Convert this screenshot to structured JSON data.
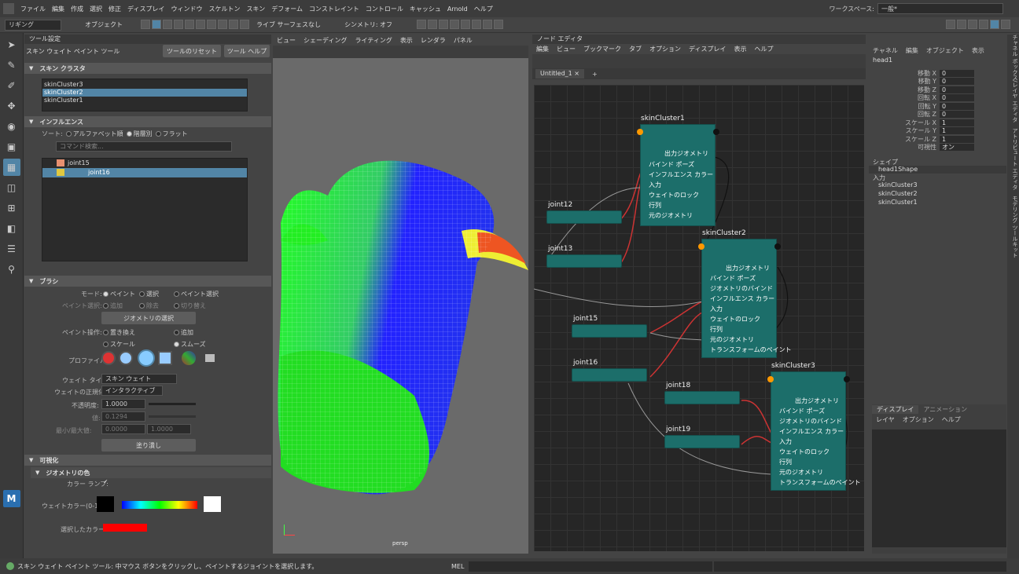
{
  "menu": [
    "ファイル",
    "編集",
    "作成",
    "選択",
    "修正",
    "ディスプレイ",
    "ウィンドウ",
    "スケルトン",
    "スキン",
    "デフォーム",
    "コンストレイント",
    "コントロール",
    "キャッシュ",
    "Arnold",
    "ヘルプ"
  ],
  "workspace": {
    "label": "ワークスペース:",
    "value": "一般*"
  },
  "shelf": {
    "mode": "リギング",
    "objects": "オブジェクト",
    "live": "ライブ サーフェスなし",
    "symmetry": "シンメトリ: オフ"
  },
  "tool": {
    "header": "ツール設定",
    "name": "スキン ウェイト ペイント ツール",
    "reset": "ツールのリセット",
    "help": "ツール ヘルプ"
  },
  "skin_cluster": {
    "title": "スキン クラスタ",
    "items": [
      "skinCluster3",
      "skinCluster2",
      "skinCluster1"
    ],
    "selected": 1
  },
  "influence": {
    "title": "インフルエンス",
    "sort": "ソート:",
    "sort_opts": [
      "アルファベット順",
      "階層別",
      "フラット"
    ],
    "search": "コマンド検索...",
    "items": [
      "joint15",
      "joint16"
    ]
  },
  "brush": {
    "title": "ブラシ",
    "mode_label": "モード:",
    "modes": [
      "ペイント",
      "選択",
      "ペイント選択"
    ],
    "paint_sel_label": "ペイント選択:",
    "paint_sel": [
      "追加",
      "除去",
      "切り替え"
    ],
    "geo_sel": "ジオメトリの選択",
    "op_label": "ペイント操作:",
    "ops": [
      "置き換え",
      "追加",
      "スケール",
      "スムーズ"
    ],
    "profile": "プロファイル:",
    "weight_type_label": "ウェイト タイプ:",
    "weight_type": "スキン ウェイト",
    "norm_label": "ウェイトの正規化:",
    "norm": "インタラクティブ",
    "opacity_label": "不透明度:",
    "opacity": "1.0000",
    "value_label": "値:",
    "value": "0.1294",
    "minmax_label": "最小/最大値:",
    "min": "0.0000",
    "max": "1.0000",
    "flood": "塗り潰し"
  },
  "display": {
    "title": "可視化",
    "geo_color": "ジオメトリの色",
    "color_ramp": "カラー ランプ:",
    "weight_color": "ウェイトカラー(0-1):",
    "sel_color": "選択したカラー:"
  },
  "viewport": {
    "menu": [
      "ビュー",
      "シェーディング",
      "ライティング",
      "表示",
      "レンダラ",
      "パネル"
    ],
    "camera": "persp"
  },
  "node_editor": {
    "title": "ノード エディタ",
    "menu": [
      "編集",
      "ビュー",
      "ブックマーク",
      "タブ",
      "オプション",
      "ディスプレイ",
      "表示",
      "ヘルプ"
    ],
    "tab": "Untitled_1"
  },
  "nodes": [
    {
      "name": "skinCluster1",
      "attrs": [
        "出力ジオメトリ",
        "バインド ポーズ",
        "インフルエンス カラー",
        "入力",
        "ウェイトのロック",
        "行列",
        "元のジオメトリ"
      ]
    },
    {
      "name": "skinCluster2",
      "attrs": [
        "出力ジオメトリ",
        "バインド ポーズ",
        "ジオメトリのバインド",
        "インフルエンス カラー",
        "入力",
        "ウェイトのロック",
        "行列",
        "元のジオメトリ",
        "トランスフォームのペイント"
      ]
    },
    {
      "name": "skinCluster3",
      "attrs": [
        "出力ジオメトリ",
        "バインド ポーズ",
        "ジオメトリのバインド",
        "インフルエンス カラー",
        "入力",
        "ウェイトのロック",
        "行列",
        "元のジオメトリ",
        "トランスフォームのペイント"
      ]
    }
  ],
  "joints": [
    "joint12",
    "joint13",
    "joint15",
    "joint16",
    "joint18",
    "joint19"
  ],
  "channel_box": {
    "menu": [
      "チャネル",
      "編集",
      "オブジェクト",
      "表示"
    ],
    "object": "head1",
    "channels": [
      [
        "移動 X",
        "0"
      ],
      [
        "移動 Y",
        "0"
      ],
      [
        "移動 Z",
        "0"
      ],
      [
        "回転 X",
        "0"
      ],
      [
        "回転 Y",
        "0"
      ],
      [
        "回転 Z",
        "0"
      ],
      [
        "スケール X",
        "1"
      ],
      [
        "スケール Y",
        "1"
      ],
      [
        "スケール Z",
        "1"
      ],
      [
        "可視性",
        "オン"
      ]
    ],
    "shape_label": "シェイプ",
    "shape": "head1Shape",
    "inputs_label": "入力",
    "inputs": [
      "skinCluster3",
      "skinCluster2",
      "skinCluster1"
    ]
  },
  "layer": {
    "tabs": [
      "ディスプレイ",
      "アニメーション"
    ],
    "menu": [
      "レイヤ",
      "オプション",
      "ヘルプ"
    ]
  },
  "sidestrip": "チャネル ボックス/レイヤ エディタ　アトリビュート エディタ　モデリング ツールキット",
  "status": {
    "text": "スキン ウェイト ペイント ツール: 中マウス ボタンをクリックし、ペイントするジョイントを選択します。",
    "mel": "MEL"
  }
}
